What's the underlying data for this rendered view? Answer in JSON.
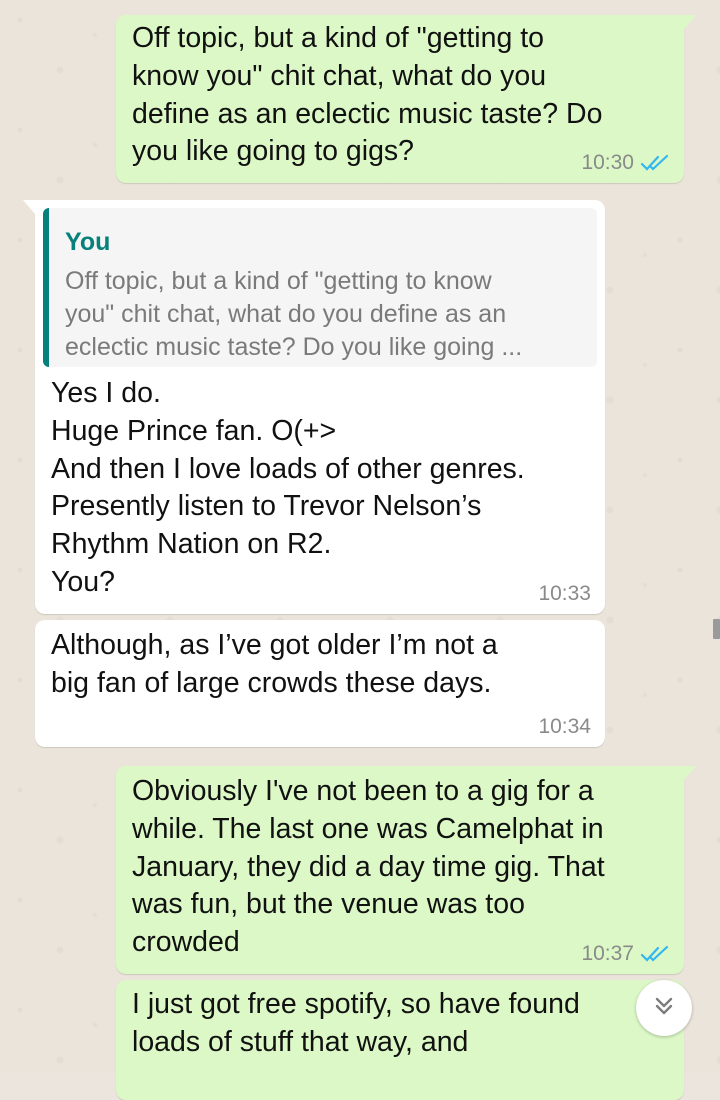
{
  "messages": [
    {
      "direction": "outgoing",
      "text": "Off topic, but a kind of \"getting to\nknow you\" chit chat, what do you\ndefine as an eclectic music taste? Do\nyou like going to gigs?",
      "time": "10:30",
      "status": "read"
    },
    {
      "direction": "incoming",
      "quoted": {
        "author": "You",
        "text": "Off topic, but a kind of \"getting to know\nyou\" chit chat, what do you define as an\neclectic music taste? Do you like going ..."
      },
      "text": "Yes I do.\nHuge Prince fan. O(+>\nAnd then I love loads of other genres.\nPresently listen to Trevor Nelson’s\nRhythm Nation on R2.\nYou?",
      "time": "10:33"
    },
    {
      "direction": "incoming",
      "text": "Although, as I’ve got older I’m not a\nbig fan of large crowds these days.",
      "time": "10:34"
    },
    {
      "direction": "outgoing",
      "text": "Obviously I've not been to a gig for a\nwhile. The last one was Camelphat in\nJanuary, they did a day time gig. That\nwas fun, but the venue was too\ncrowded",
      "time": "10:37",
      "status": "read"
    },
    {
      "direction": "outgoing",
      "text": "I just got free spotify, so have found\nloads of stuff that way, and"
    }
  ],
  "icons": {
    "read_receipt": "double-check-icon",
    "scroll_down": "double-chevron-down-icon"
  },
  "colors": {
    "outgoing_bubble": "#dcf8c6",
    "incoming_bubble": "#ffffff",
    "read_tick": "#34b7f1",
    "quote_accent": "#06807a",
    "wallpaper": "#ebe4da"
  }
}
